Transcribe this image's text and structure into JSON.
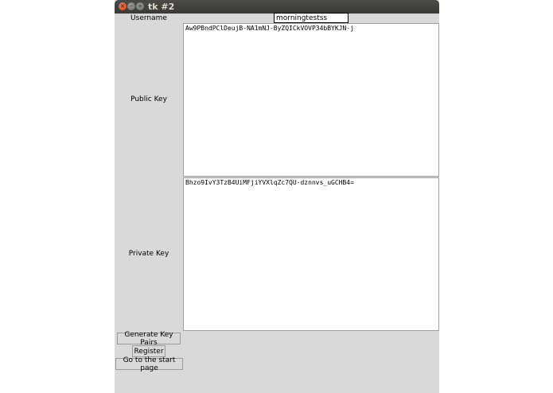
{
  "window": {
    "title": "tk #2",
    "close_glyph": "×",
    "min_glyph": "–",
    "max_glyph": "+"
  },
  "form": {
    "username_label": "Username",
    "username_value": "morningtestss",
    "public_key_label": "Public Key",
    "public_key_value": "Aw9PBndPClDeujB-NA1mNJ-ByZQICkVOVP34bBYKJN-j",
    "private_key_label": "Private Key",
    "private_key_value": "Bhzo9IvY3TzB4UiMFjiYVXlqZc7QU-dznnvs_uGCHB4="
  },
  "buttons": {
    "generate_label": "Generate Key Pairs",
    "register_label": "Register",
    "start_page_label": "Go to the start page"
  },
  "colors": {
    "window_bg": "#d9d9d9",
    "titlebar": "#3c3b37",
    "close_button": "#e0531f"
  }
}
